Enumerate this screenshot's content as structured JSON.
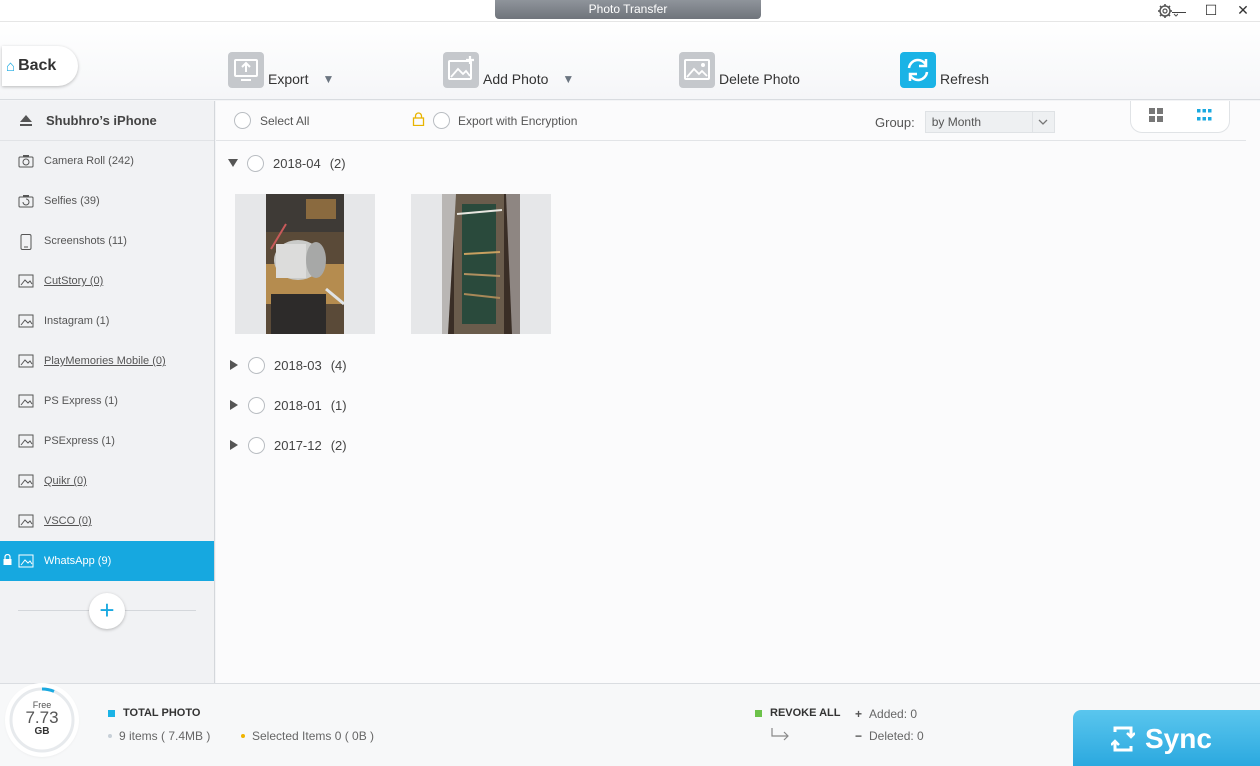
{
  "window": {
    "title": "Photo Transfer",
    "controls": [
      "—",
      "☐",
      "✕"
    ]
  },
  "toolbar": {
    "back_label": "Back",
    "export_label": "Export",
    "add_photo_label": "Add Photo",
    "delete_photo_label": "Delete Photo",
    "refresh_label": "Refresh"
  },
  "sidebar": {
    "device_name": "Shubhro’s iPhone",
    "albums": [
      {
        "label": "Camera Roll (242)",
        "icon": "camera-icon"
      },
      {
        "label": "Selfies (39)",
        "icon": "selfie-camera-icon"
      },
      {
        "label": "Screenshots (11)",
        "icon": "phone-icon"
      },
      {
        "label": "CutStory (0)",
        "icon": "image-icon"
      },
      {
        "label": "Instagram (1)",
        "icon": "image-icon"
      },
      {
        "label": "PlayMemories Mobile (0)",
        "icon": "image-icon"
      },
      {
        "label": "PS Express (1)",
        "icon": "image-icon"
      },
      {
        "label": "PSExpress (1)",
        "icon": "image-icon"
      },
      {
        "label": "Quikr (0)",
        "icon": "image-icon"
      },
      {
        "label": "VSCO (0)",
        "icon": "image-icon"
      },
      {
        "label": "WhatsApp (9)",
        "icon": "image-icon",
        "active": true,
        "locked": true
      }
    ]
  },
  "main": {
    "select_all_label": "Select All",
    "export_encryption_label": "Export with Encryption",
    "group_label": "Group:",
    "group_value": "by Month",
    "months": [
      {
        "label": "2018-04",
        "count": "(2)",
        "expanded": true
      },
      {
        "label": "2018-03",
        "count": "(4)",
        "expanded": false
      },
      {
        "label": "2018-01",
        "count": "(1)",
        "expanded": false
      },
      {
        "label": "2017-12",
        "count": "(2)",
        "expanded": false
      }
    ]
  },
  "footer": {
    "free_label": "Free",
    "free_value": "7.73",
    "free_unit": "GB",
    "total_photo_label": "TOTAL PHOTO",
    "items_text": "9 items ( 7.4MB )",
    "selected_text": "Selected Items 0 ( 0B )",
    "revoke_all_label": "REVOKE ALL",
    "added_text": "Added: 0",
    "deleted_text": "Deleted: 0",
    "sync_label": "Sync"
  },
  "colors": {
    "accent": "#16a8e0",
    "total_square": "#1ab3e6",
    "revoke_square": "#6cc24a",
    "selected_dot": "#f0b400",
    "items_dot": "#c8d0d8"
  }
}
